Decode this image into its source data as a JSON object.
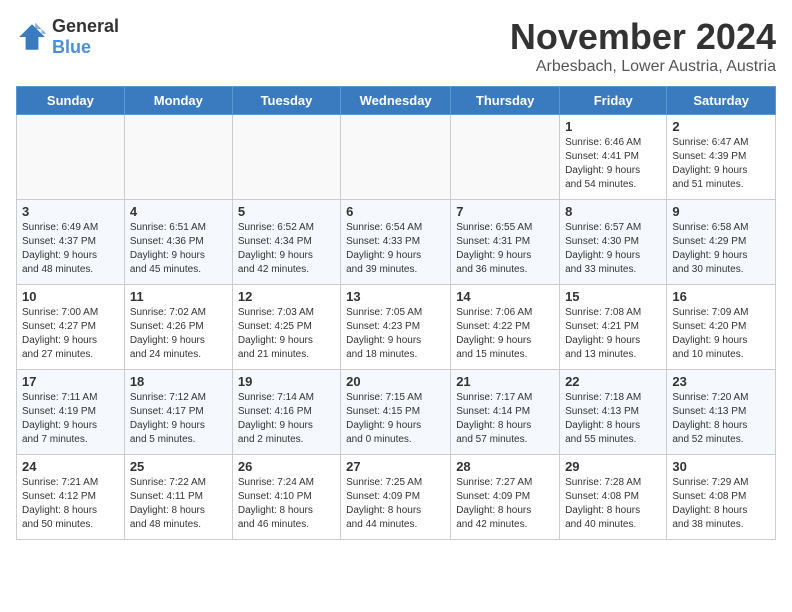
{
  "logo": {
    "general": "General",
    "blue": "Blue"
  },
  "title": {
    "month": "November 2024",
    "location": "Arbesbach, Lower Austria, Austria"
  },
  "weekdays": [
    "Sunday",
    "Monday",
    "Tuesday",
    "Wednesday",
    "Thursday",
    "Friday",
    "Saturday"
  ],
  "weeks": [
    [
      {
        "day": "",
        "info": ""
      },
      {
        "day": "",
        "info": ""
      },
      {
        "day": "",
        "info": ""
      },
      {
        "day": "",
        "info": ""
      },
      {
        "day": "",
        "info": ""
      },
      {
        "day": "1",
        "info": "Sunrise: 6:46 AM\nSunset: 4:41 PM\nDaylight: 9 hours\nand 54 minutes."
      },
      {
        "day": "2",
        "info": "Sunrise: 6:47 AM\nSunset: 4:39 PM\nDaylight: 9 hours\nand 51 minutes."
      }
    ],
    [
      {
        "day": "3",
        "info": "Sunrise: 6:49 AM\nSunset: 4:37 PM\nDaylight: 9 hours\nand 48 minutes."
      },
      {
        "day": "4",
        "info": "Sunrise: 6:51 AM\nSunset: 4:36 PM\nDaylight: 9 hours\nand 45 minutes."
      },
      {
        "day": "5",
        "info": "Sunrise: 6:52 AM\nSunset: 4:34 PM\nDaylight: 9 hours\nand 42 minutes."
      },
      {
        "day": "6",
        "info": "Sunrise: 6:54 AM\nSunset: 4:33 PM\nDaylight: 9 hours\nand 39 minutes."
      },
      {
        "day": "7",
        "info": "Sunrise: 6:55 AM\nSunset: 4:31 PM\nDaylight: 9 hours\nand 36 minutes."
      },
      {
        "day": "8",
        "info": "Sunrise: 6:57 AM\nSunset: 4:30 PM\nDaylight: 9 hours\nand 33 minutes."
      },
      {
        "day": "9",
        "info": "Sunrise: 6:58 AM\nSunset: 4:29 PM\nDaylight: 9 hours\nand 30 minutes."
      }
    ],
    [
      {
        "day": "10",
        "info": "Sunrise: 7:00 AM\nSunset: 4:27 PM\nDaylight: 9 hours\nand 27 minutes."
      },
      {
        "day": "11",
        "info": "Sunrise: 7:02 AM\nSunset: 4:26 PM\nDaylight: 9 hours\nand 24 minutes."
      },
      {
        "day": "12",
        "info": "Sunrise: 7:03 AM\nSunset: 4:25 PM\nDaylight: 9 hours\nand 21 minutes."
      },
      {
        "day": "13",
        "info": "Sunrise: 7:05 AM\nSunset: 4:23 PM\nDaylight: 9 hours\nand 18 minutes."
      },
      {
        "day": "14",
        "info": "Sunrise: 7:06 AM\nSunset: 4:22 PM\nDaylight: 9 hours\nand 15 minutes."
      },
      {
        "day": "15",
        "info": "Sunrise: 7:08 AM\nSunset: 4:21 PM\nDaylight: 9 hours\nand 13 minutes."
      },
      {
        "day": "16",
        "info": "Sunrise: 7:09 AM\nSunset: 4:20 PM\nDaylight: 9 hours\nand 10 minutes."
      }
    ],
    [
      {
        "day": "17",
        "info": "Sunrise: 7:11 AM\nSunset: 4:19 PM\nDaylight: 9 hours\nand 7 minutes."
      },
      {
        "day": "18",
        "info": "Sunrise: 7:12 AM\nSunset: 4:17 PM\nDaylight: 9 hours\nand 5 minutes."
      },
      {
        "day": "19",
        "info": "Sunrise: 7:14 AM\nSunset: 4:16 PM\nDaylight: 9 hours\nand 2 minutes."
      },
      {
        "day": "20",
        "info": "Sunrise: 7:15 AM\nSunset: 4:15 PM\nDaylight: 9 hours\nand 0 minutes."
      },
      {
        "day": "21",
        "info": "Sunrise: 7:17 AM\nSunset: 4:14 PM\nDaylight: 8 hours\nand 57 minutes."
      },
      {
        "day": "22",
        "info": "Sunrise: 7:18 AM\nSunset: 4:13 PM\nDaylight: 8 hours\nand 55 minutes."
      },
      {
        "day": "23",
        "info": "Sunrise: 7:20 AM\nSunset: 4:13 PM\nDaylight: 8 hours\nand 52 minutes."
      }
    ],
    [
      {
        "day": "24",
        "info": "Sunrise: 7:21 AM\nSunset: 4:12 PM\nDaylight: 8 hours\nand 50 minutes."
      },
      {
        "day": "25",
        "info": "Sunrise: 7:22 AM\nSunset: 4:11 PM\nDaylight: 8 hours\nand 48 minutes."
      },
      {
        "day": "26",
        "info": "Sunrise: 7:24 AM\nSunset: 4:10 PM\nDaylight: 8 hours\nand 46 minutes."
      },
      {
        "day": "27",
        "info": "Sunrise: 7:25 AM\nSunset: 4:09 PM\nDaylight: 8 hours\nand 44 minutes."
      },
      {
        "day": "28",
        "info": "Sunrise: 7:27 AM\nSunset: 4:09 PM\nDaylight: 8 hours\nand 42 minutes."
      },
      {
        "day": "29",
        "info": "Sunrise: 7:28 AM\nSunset: 4:08 PM\nDaylight: 8 hours\nand 40 minutes."
      },
      {
        "day": "30",
        "info": "Sunrise: 7:29 AM\nSunset: 4:08 PM\nDaylight: 8 hours\nand 38 minutes."
      }
    ]
  ]
}
